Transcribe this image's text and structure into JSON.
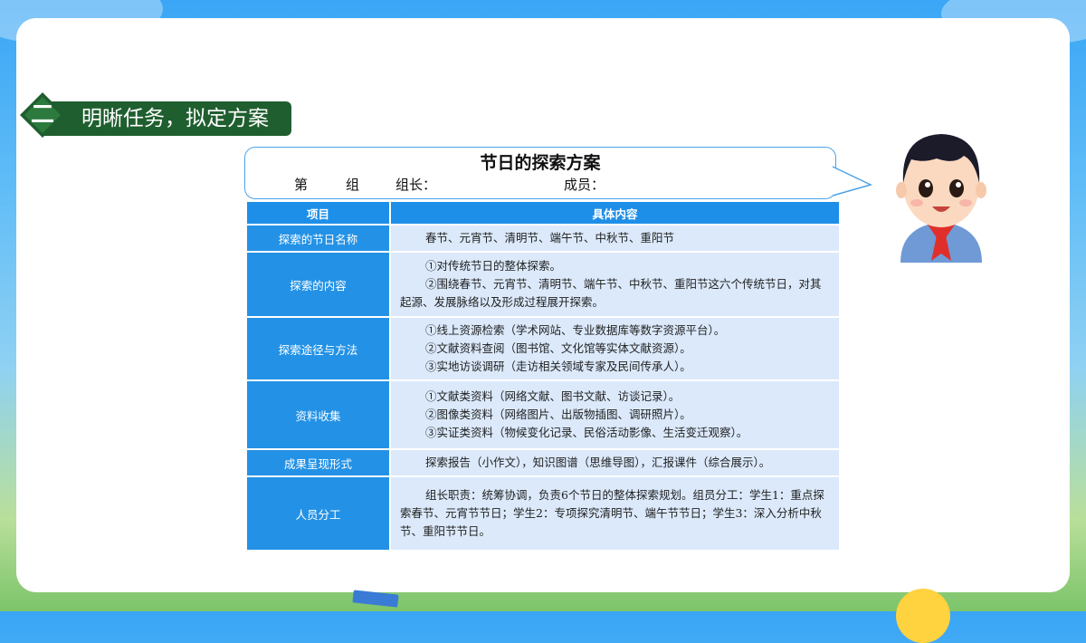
{
  "section": {
    "number": "二",
    "title": "明晰任务，拟定方案"
  },
  "plan": {
    "title": "节日的探索方案",
    "group_prefix": "第",
    "group_suffix": "组",
    "leader_label": "组长：",
    "members_label": "成员："
  },
  "table": {
    "headers": [
      "项目",
      "具体内容"
    ],
    "rows": [
      {
        "label": "探索的节日名称",
        "lines": [
          "春节、元宵节、清明节、端午节、中秋节、重阳节"
        ]
      },
      {
        "label": "探索的内容",
        "lines": [
          "①对传统节日的整体探索。",
          "②围绕春节、元宵节、清明节、端午节、中秋节、重阳节这六个传统节日，对其起源、发展脉络以及形成过程展开探索。"
        ]
      },
      {
        "label": "探索途径与方法",
        "lines": [
          "①线上资源检索（学术网站、专业数据库等数字资源平台）。",
          "②文献资料查阅（图书馆、文化馆等实体文献资源）。",
          "③实地访谈调研（走访相关领域专家及民间传承人）。"
        ]
      },
      {
        "label": "资料收集",
        "lines": [
          "①文献类资料（网络文献、图书文献、访谈记录）。",
          "②图像类资料（网络图片、出版物插图、调研照片）。",
          "③实证类资料（物候变化记录、民俗活动影像、生活变迁观察）。"
        ]
      },
      {
        "label": "成果呈现形式",
        "lines": [
          "探索报告（小作文），知识图谱（思维导图），汇报课件（综合展示）。"
        ]
      },
      {
        "label": "人员分工",
        "lines": [
          "组长职责：统筹协调，负责6个节日的整体探索规划。组员分工：学生1：重点探索春节、元宵节节日；学生2：专项探究清明节、端午节节日；学生3：深入分析中秋节、重阳节节日。"
        ]
      }
    ]
  },
  "colors": {
    "header_blue": "#1e8fe8",
    "label_blue": "#2392e6",
    "cell_bg": "#dbe9fb",
    "section_green": "#1f5e2e"
  }
}
